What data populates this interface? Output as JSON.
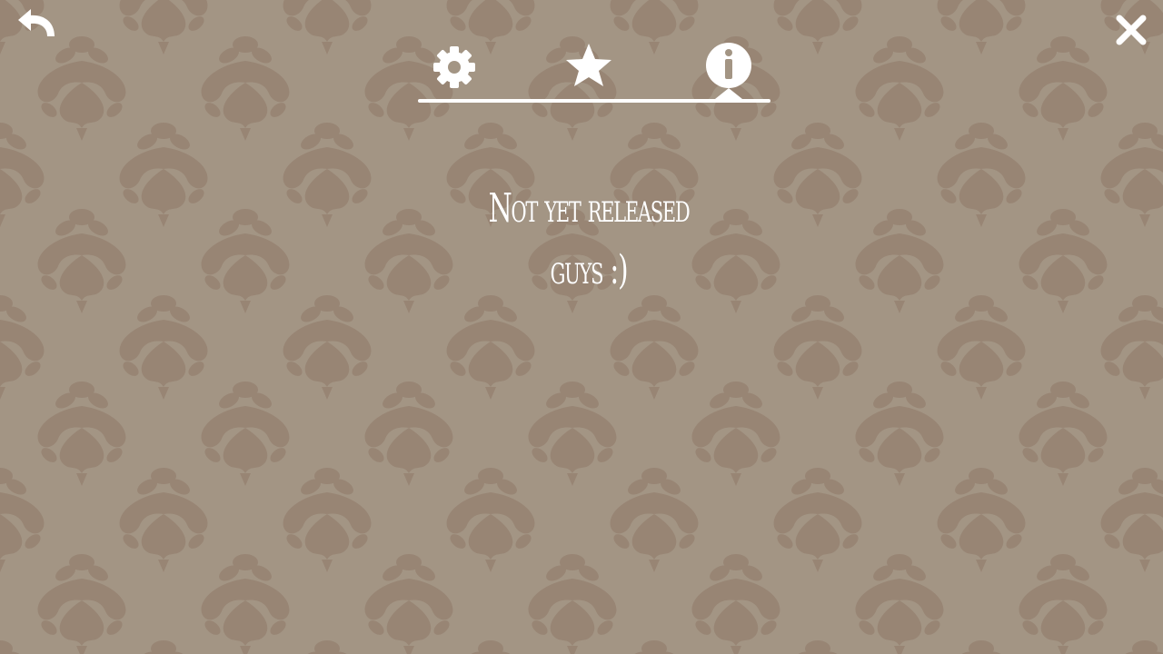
{
  "colors": {
    "background": "#a39584",
    "pattern": "#94806f",
    "icon": "#ffffff"
  },
  "toolbar": {
    "back_icon": "undo-arrow-icon",
    "close_icon": "close-x-icon"
  },
  "tabs": [
    {
      "id": "settings",
      "icon": "gear-icon",
      "selected": false
    },
    {
      "id": "favorites",
      "icon": "star-icon",
      "selected": false
    },
    {
      "id": "info",
      "icon": "info-circle-icon",
      "selected": true
    }
  ],
  "message": {
    "line1": "Not yet released",
    "line2": "guys :)"
  }
}
